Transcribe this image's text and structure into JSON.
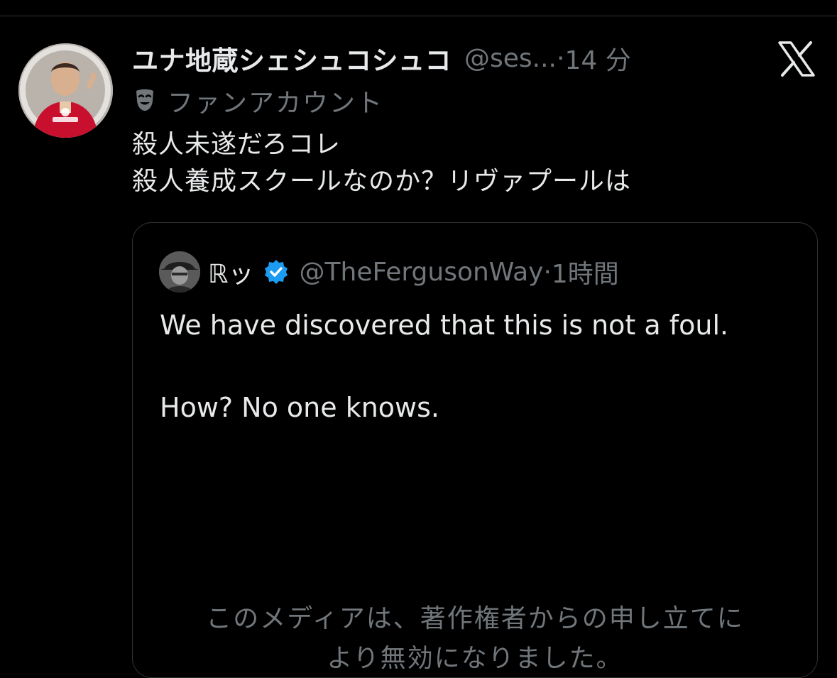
{
  "tweet": {
    "display_name": "ユナ地蔵シェシュコシュコ",
    "handle": "@ses...",
    "separator": "·",
    "time": "14 分",
    "label_icon": "theater-masks-icon",
    "label": "ファンアカウント",
    "text_lines": [
      "殺人未遂だろコレ",
      "殺人養成スクールなのか？リヴァプールは"
    ]
  },
  "quote": {
    "display_name": "ℝッ",
    "verified_icon": "verified-badge-icon",
    "handle": "@TheFergusonWay",
    "separator": "·",
    "time": "1時間",
    "text_lines": [
      "We have discovered that this is not a foul.",
      "",
      "How? No one knows."
    ],
    "media_notice_lines": [
      "このメディアは、著作権者からの申し立てに",
      "より無効になりました。"
    ]
  },
  "colors": {
    "background": "#000000",
    "text": "#e7e9ea",
    "secondary": "#71767b",
    "border": "#2f3336",
    "verified": "#1d9bf0"
  }
}
